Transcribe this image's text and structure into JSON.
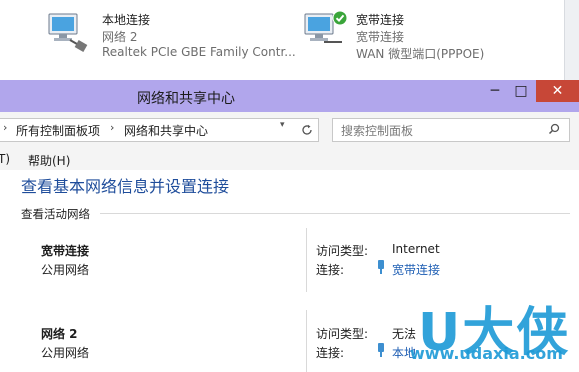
{
  "connections": [
    {
      "name": "本地连接",
      "network": "网络  2",
      "device": "Realtek PCIe GBE Family Contr..."
    },
    {
      "name": "宽带连接",
      "network": "宽带连接",
      "device": "WAN 微型端口(PPPOE)"
    }
  ],
  "window": {
    "title": "网络和共享中心",
    "minimize": "─",
    "maximize": "□",
    "close": "✕"
  },
  "address": {
    "crumbs": [
      "所有控制面板项",
      "网络和共享中心"
    ],
    "search_placeholder": "搜索控制面板"
  },
  "menu": {
    "partial_item": "T)",
    "help": "帮助(H)"
  },
  "main": {
    "heading": "查看基本网络信息并设置连接",
    "active_networks_label": "查看活动网络",
    "networks": [
      {
        "name": "宽带连接",
        "category": "公用网络",
        "access_label": "访问类型:",
        "access_value": "Internet",
        "conn_label": "连接:",
        "conn_value": "宽带连接"
      },
      {
        "name": "网络  2",
        "category": "公用网络",
        "access_label": "访问类型:",
        "access_value": "无法",
        "conn_label": "连接:",
        "conn_value": "本地"
      }
    ]
  },
  "watermark": {
    "brand": "U大侠",
    "url": "www.udaxia.com"
  },
  "icons": {
    "check_color": "#3aa53a",
    "titlebar_color": "#b1a6ec",
    "close_color": "#c74737",
    "link_color": "#1f5fb4"
  }
}
